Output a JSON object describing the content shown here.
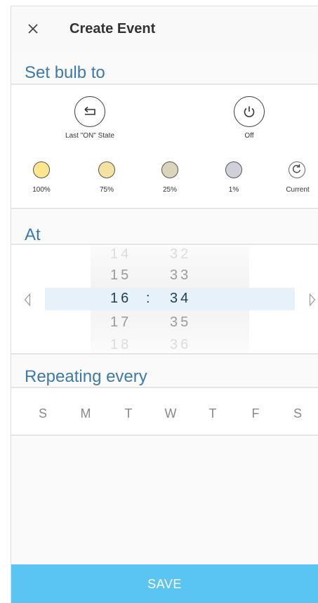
{
  "header": {
    "title": "Create Event",
    "close_icon": "close-icon"
  },
  "set_bulb": {
    "title": "Set bulb to",
    "states": [
      {
        "label": "Last \"ON\" State",
        "icon": "return-icon"
      },
      {
        "label": "Off",
        "icon": "power-icon"
      }
    ],
    "brightness": [
      {
        "label": "100%",
        "color": "#fde68e"
      },
      {
        "label": "75%",
        "color": "#f5e2a1"
      },
      {
        "label": "25%",
        "color": "#dad4bb"
      },
      {
        "label": "1%",
        "color": "#d0d0da"
      },
      {
        "label": "Current",
        "icon": "refresh-icon"
      }
    ]
  },
  "at": {
    "title": "At",
    "hours": [
      "14",
      "15",
      "16",
      "17",
      "18"
    ],
    "minutes": [
      "32",
      "33",
      "34",
      "35",
      "36"
    ],
    "selected_hour": "16",
    "selected_minute": "34",
    "separator": ":"
  },
  "repeating": {
    "title": "Repeating every",
    "days": [
      "S",
      "M",
      "T",
      "W",
      "T",
      "F",
      "S"
    ]
  },
  "footer": {
    "save_label": "SAVE"
  },
  "colors": {
    "accent": "#3d7aa8",
    "save": "#5bc5f1",
    "selection": "#e6f1fa"
  }
}
